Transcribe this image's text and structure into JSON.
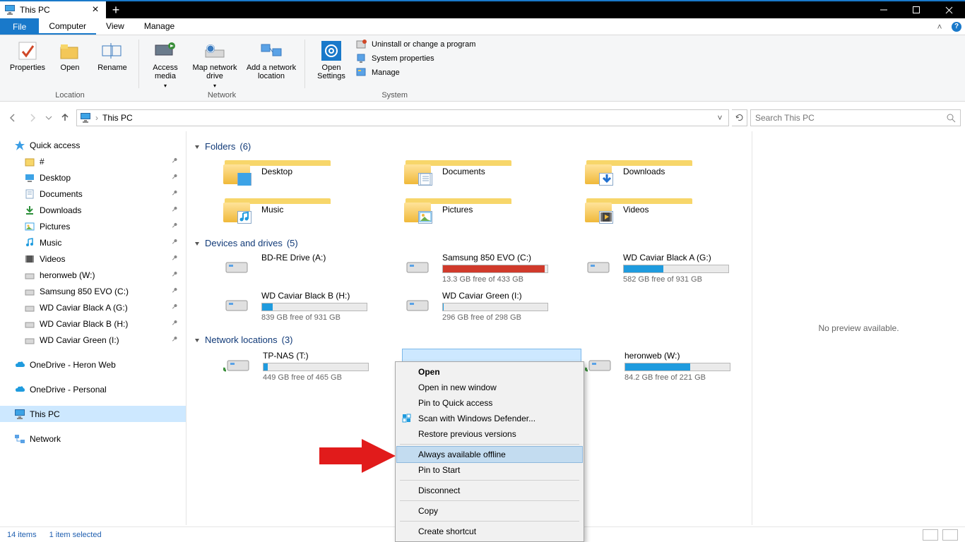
{
  "window": {
    "title": "This PC"
  },
  "ribbon_tabs": {
    "file": "File",
    "computer": "Computer",
    "view": "View",
    "manage": "Manage"
  },
  "ribbon": {
    "location": {
      "label": "Location",
      "properties": "Properties",
      "open": "Open",
      "rename": "Rename"
    },
    "network": {
      "label": "Network",
      "access_media": "Access media",
      "map_drive": "Map network drive",
      "add_location": "Add a network location"
    },
    "settings": {
      "open_settings": "Open Settings"
    },
    "system": {
      "label": "System",
      "uninstall": "Uninstall or change a program",
      "sysprops": "System properties",
      "manage": "Manage"
    }
  },
  "addressbar": {
    "location": "This PC"
  },
  "search": {
    "placeholder": "Search This PC"
  },
  "sidebar": {
    "quick_access": "Quick access",
    "items": [
      {
        "label": "#"
      },
      {
        "label": "Desktop"
      },
      {
        "label": "Documents"
      },
      {
        "label": "Downloads"
      },
      {
        "label": "Pictures"
      },
      {
        "label": "Music"
      },
      {
        "label": "Videos"
      },
      {
        "label": "heronweb (W:)"
      },
      {
        "label": "Samsung 850 EVO (C:)"
      },
      {
        "label": "WD Caviar Black A (G:)"
      },
      {
        "label": "WD Caviar Black B (H:)"
      },
      {
        "label": "WD Caviar Green (I:)"
      }
    ],
    "onedrive1": "OneDrive - Heron Web",
    "onedrive2": "OneDrive - Personal",
    "this_pc": "This PC",
    "network": "Network"
  },
  "sections": {
    "folders": {
      "title": "Folders",
      "count": "(6)",
      "items": [
        "Desktop",
        "Documents",
        "Downloads",
        "Music",
        "Pictures",
        "Videos"
      ]
    },
    "drives": {
      "title": "Devices and drives",
      "count": "(5)",
      "items": [
        {
          "name": "BD-RE Drive (A:)",
          "free": "",
          "pct": 0,
          "color": "none"
        },
        {
          "name": "Samsung 850 EVO (C:)",
          "free": "13.3 GB free of 433 GB",
          "pct": 97,
          "color": "red"
        },
        {
          "name": "WD Caviar Black A (G:)",
          "free": "582 GB free of 931 GB",
          "pct": 38,
          "color": "blue"
        },
        {
          "name": "WD Caviar Black B (H:)",
          "free": "839 GB free of 931 GB",
          "pct": 10,
          "color": "blue"
        },
        {
          "name": "WD Caviar Green (I:)",
          "free": "296 GB free of 298 GB",
          "pct": 1,
          "color": "blue"
        }
      ]
    },
    "network": {
      "title": "Network locations",
      "count": "(3)",
      "items": [
        {
          "name": "TP-NAS (T:)",
          "free": "449 GB free of 465 GB",
          "pct": 4
        },
        {
          "name": "",
          "free": "",
          "pct": 0,
          "selected": true
        },
        {
          "name": "heronweb (W:)",
          "free": "84.2 GB free of 221 GB",
          "pct": 62
        }
      ]
    }
  },
  "preview": {
    "text": "No preview available."
  },
  "context_menu": {
    "open": "Open",
    "open_new": "Open in new window",
    "pin_qa": "Pin to Quick access",
    "scan": "Scan with Windows Defender...",
    "restore": "Restore previous versions",
    "always_offline": "Always available offline",
    "pin_start": "Pin to Start",
    "disconnect": "Disconnect",
    "copy": "Copy",
    "shortcut": "Create shortcut"
  },
  "status": {
    "items": "14 items",
    "selected": "1 item selected"
  }
}
